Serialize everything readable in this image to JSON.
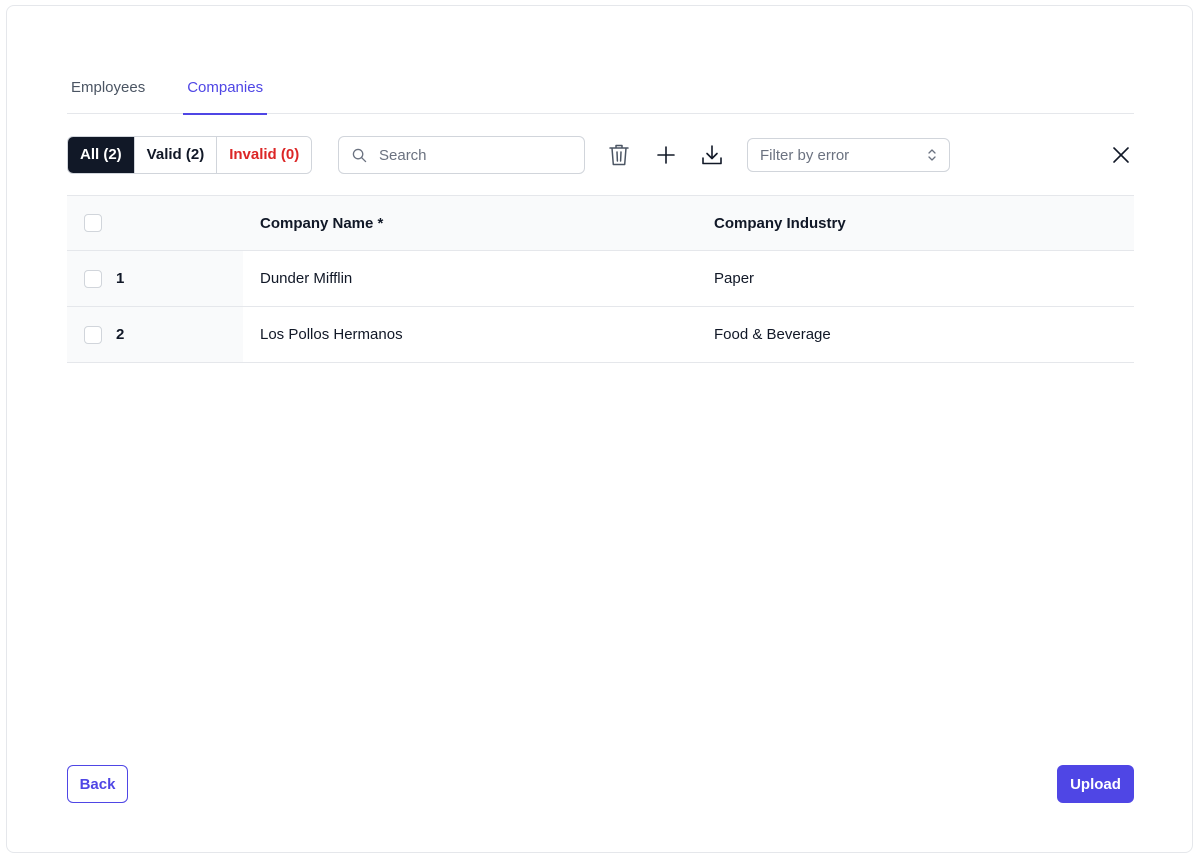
{
  "tabs": [
    {
      "label": "Employees",
      "active": false
    },
    {
      "label": "Companies",
      "active": true
    }
  ],
  "filters": {
    "all": "All (2)",
    "valid": "Valid (2)",
    "invalid": "Invalid (0)"
  },
  "search": {
    "placeholder": "Search",
    "value": ""
  },
  "toolbar_icons": [
    "trash-icon",
    "plus-icon",
    "download-icon",
    "close-icon"
  ],
  "error_filter": {
    "placeholder": "Filter by error"
  },
  "table": {
    "columns": [
      "Company Name *",
      "Company Industry"
    ],
    "rows": [
      {
        "index": "1",
        "name": "Dunder Mifflin",
        "industry": "Paper"
      },
      {
        "index": "2",
        "name": "Los Pollos Hermanos",
        "industry": "Food & Beverage"
      }
    ]
  },
  "footer": {
    "back_label": "Back",
    "upload_label": "Upload"
  },
  "colors": {
    "accent": "#4f46e5",
    "invalid": "#dc2626",
    "active_segment": "#111827"
  }
}
